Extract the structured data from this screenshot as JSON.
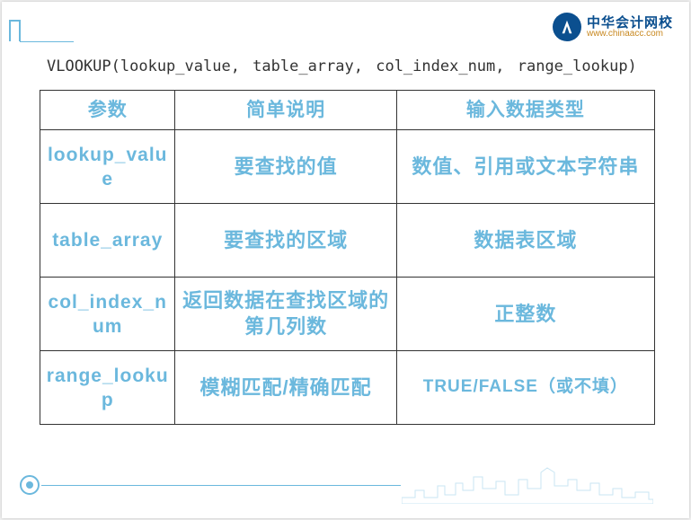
{
  "logo": {
    "cn": "中华会计网校",
    "url": "www.chinaacc.com"
  },
  "formula": "VLOOKUP(lookup_value,  table_array,   col_index_num,  range_lookup)",
  "table": {
    "header": {
      "col1": "参数",
      "col2": "简单说明",
      "col3": "输入数据类型"
    },
    "rows": [
      {
        "param": "lookup_value",
        "desc": "要查找的值",
        "type": "数值、引用或文本字符串"
      },
      {
        "param": "table_array",
        "desc": "要查找的区域",
        "type": "数据表区域"
      },
      {
        "param": "col_index_num",
        "desc": "返回数据在查找区域的第几列数",
        "type": "正整数"
      },
      {
        "param": "range_lookup",
        "desc": "模糊匹配/精确匹配",
        "type": "TRUE/FALSE（或不填）"
      }
    ]
  }
}
